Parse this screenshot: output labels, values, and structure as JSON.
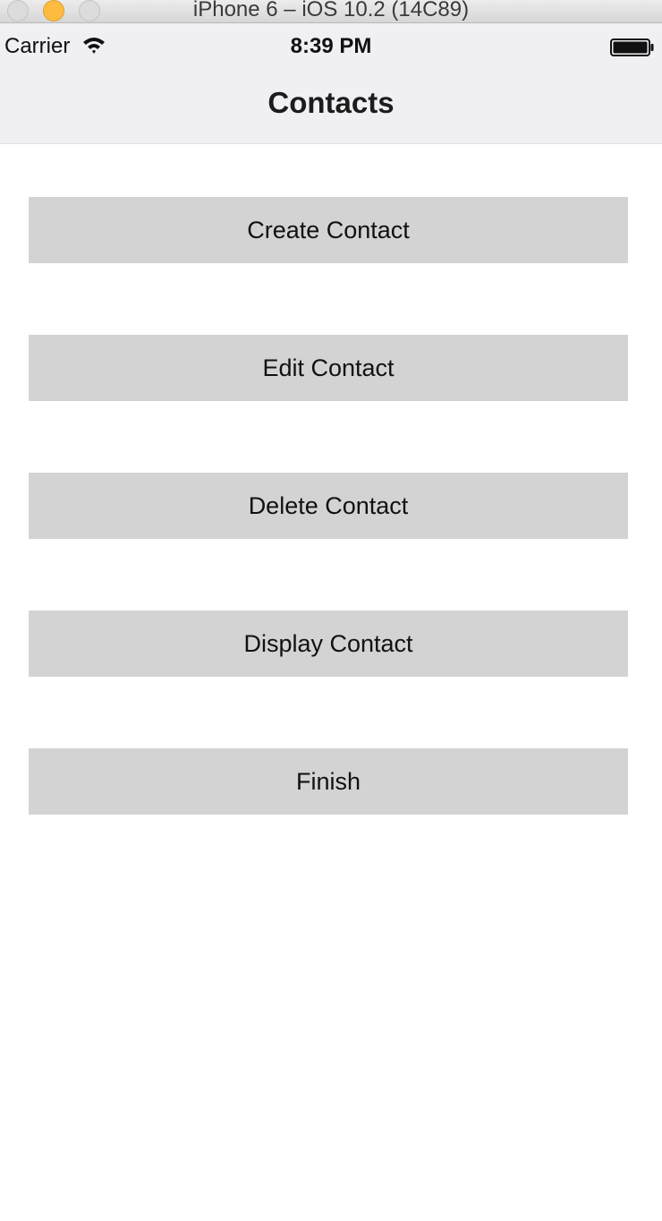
{
  "window": {
    "title": "iPhone 6 – iOS 10.2 (14C89)"
  },
  "status_bar": {
    "carrier": "Carrier",
    "time": "8:39 PM",
    "icons": [
      "wifi-icon",
      "battery-icon"
    ]
  },
  "nav": {
    "title": "Contacts"
  },
  "buttons": [
    {
      "label": "Create Contact"
    },
    {
      "label": "Edit Contact"
    },
    {
      "label": "Delete Contact"
    },
    {
      "label": "Display Contact"
    },
    {
      "label": "Finish"
    }
  ],
  "colors": {
    "button_bg": "#d3d3d3",
    "header_bg": "#efeff4",
    "minimize_light": "#fdbc40"
  }
}
